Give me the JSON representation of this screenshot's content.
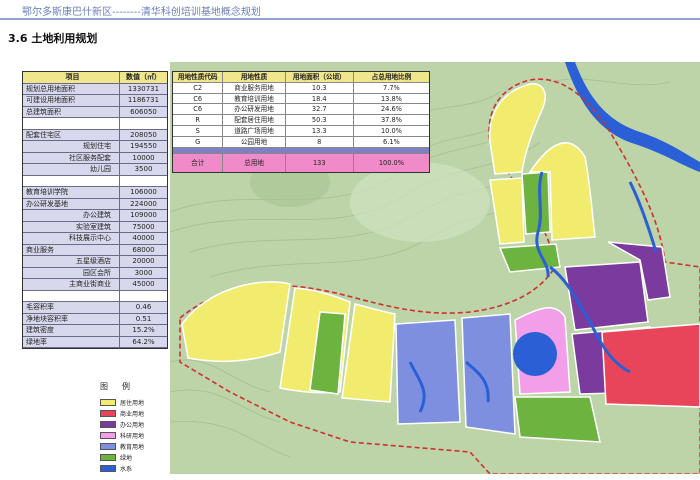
{
  "header": {
    "title": "鄂尔多斯康巴什新区--------清华科创培训基地概念规划"
  },
  "section": {
    "title": "3.6  土地利用规划"
  },
  "stats_table": {
    "headers": [
      "项目",
      "数值（㎡）"
    ],
    "rows": [
      {
        "label": "规划总用地面积",
        "value": "1330731",
        "indent": false
      },
      {
        "label": "可建设用地面积",
        "value": "1186731",
        "indent": false
      },
      {
        "label": "总建筑面积",
        "value": "606050",
        "indent": false
      },
      {
        "label": "",
        "value": "",
        "indent": false
      },
      {
        "label": "配套住宅区",
        "value": "208050",
        "indent": false
      },
      {
        "label": "规划住宅",
        "value": "194550",
        "indent": true
      },
      {
        "label": "社区服务配套",
        "value": "10000",
        "indent": true
      },
      {
        "label": "幼儿园",
        "value": "3500",
        "indent": true
      },
      {
        "label": "",
        "value": "",
        "indent": false
      },
      {
        "label": "教育培训学院",
        "value": "106000",
        "indent": false
      },
      {
        "label": "办公研发基地",
        "value": "224000",
        "indent": false
      },
      {
        "label": "办公建筑",
        "value": "109000",
        "indent": true
      },
      {
        "label": "实验室建筑",
        "value": "75000",
        "indent": true
      },
      {
        "label": "科技展示中心",
        "value": "40000",
        "indent": true
      },
      {
        "label": "商业服务",
        "value": "68000",
        "indent": false
      },
      {
        "label": "五星级酒店",
        "value": "20000",
        "indent": true
      },
      {
        "label": "园区会所",
        "value": "3000",
        "indent": true
      },
      {
        "label": "主商业街商业",
        "value": "45000",
        "indent": true
      },
      {
        "label": "",
        "value": "",
        "indent": false
      },
      {
        "label": "毛容积率",
        "value": "0.46",
        "indent": false
      },
      {
        "label": "净地块容积率",
        "value": "0.51",
        "indent": false
      },
      {
        "label": "建筑密度",
        "value": "15.2%",
        "indent": false
      },
      {
        "label": "绿地率",
        "value": "64.2%",
        "indent": false
      }
    ]
  },
  "landuse_table": {
    "headers": [
      "用地性质代码",
      "用地性质",
      "用地面积（公顷）",
      "占总用地比例"
    ],
    "rows": [
      [
        "C2",
        "商业服务用地",
        "10.3",
        "7.7%"
      ],
      [
        "C6",
        "教育培训用地",
        "18.4",
        "13.8%"
      ],
      [
        "C6",
        "办公研发用地",
        "32.7",
        "24.6%"
      ],
      [
        "R",
        "配套居住用地",
        "50.3",
        "37.8%"
      ],
      [
        "S",
        "道路广场用地",
        "13.3",
        "10.0%"
      ],
      [
        "G",
        "公园用地",
        "8",
        "6.1%"
      ]
    ],
    "total": [
      "合计",
      "总用地",
      "133",
      "100.0%"
    ]
  },
  "legend": {
    "title": "图例",
    "items": [
      {
        "label": "居住用地",
        "color": "#f2ec6e"
      },
      {
        "label": "商业用地",
        "color": "#e8455a"
      },
      {
        "label": "办公用地",
        "color": "#7b3a9e"
      },
      {
        "label": "科研用地",
        "color": "#f39ee8"
      },
      {
        "label": "教育用地",
        "color": "#7f8fe0"
      },
      {
        "label": "绿地",
        "color": "#6db33f"
      },
      {
        "label": "水系",
        "color": "#2a5fd6"
      }
    ]
  },
  "colors": {
    "residential": "#f2ec6e",
    "commercial": "#e8455a",
    "office": "#7b3a9e",
    "research": "#f39ee8",
    "education": "#7f8fe0",
    "green": "#6db33f",
    "water": "#2a5fd6",
    "terrain": "#b9d0a6",
    "boundary": "#d03030"
  }
}
